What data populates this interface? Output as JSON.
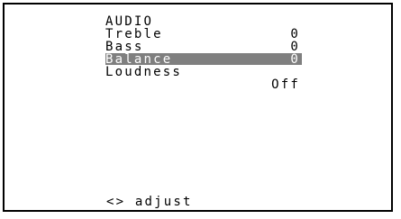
{
  "menu": {
    "title": "AUDIO",
    "items": [
      {
        "label": "Treble",
        "value": "0",
        "selected": false
      },
      {
        "label": "Bass",
        "value": "0",
        "selected": false
      },
      {
        "label": "Balance",
        "value": "0",
        "selected": true
      },
      {
        "label": "Loudness",
        "value": "",
        "selected": false
      }
    ],
    "loudness_value": "Off",
    "hint": "<> adjust"
  },
  "colors": {
    "background": "#ffffff",
    "text": "#000000",
    "highlight": "#7f7f7f",
    "highlight_text": "#ffffff"
  }
}
